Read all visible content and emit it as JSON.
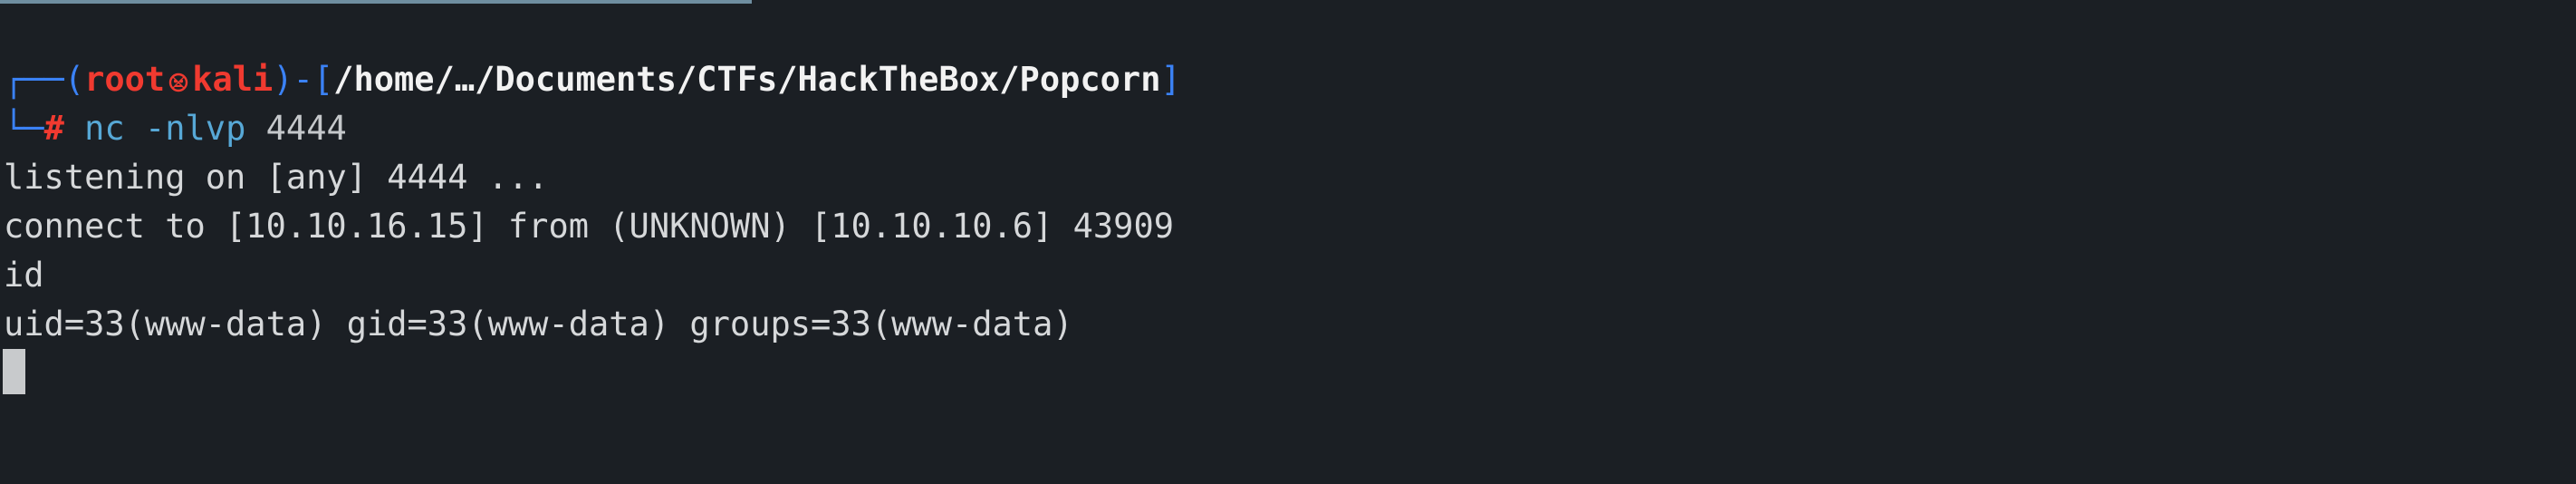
{
  "prompt": {
    "box_top": "┌──",
    "open_paren": "(",
    "user": "root",
    "host": "kali",
    "close_paren_dash": ")-",
    "open_bracket": "[",
    "path": "/home/…/Documents/CTFs/HackTheBox/Popcorn",
    "close_bracket": "]",
    "box_bottom": "└─",
    "hash": "#",
    "command": "nc",
    "args": "-nlvp",
    "port": "4444"
  },
  "output": [
    "listening on [any] 4444 ...",
    "connect to [10.10.16.15] from (UNKNOWN) [10.10.10.6] 43909",
    "id",
    "uid=33(www-data) gid=33(www-data) groups=33(www-data)"
  ],
  "colors": {
    "background": "#1b1f24",
    "prompt_frame": "#3b82f6",
    "user_host": "#f03a30",
    "path": "#f2f2f2",
    "command": "#57a8d6",
    "text": "#d6d8da"
  },
  "icons": {
    "user_host_separator": "skull-icon"
  }
}
